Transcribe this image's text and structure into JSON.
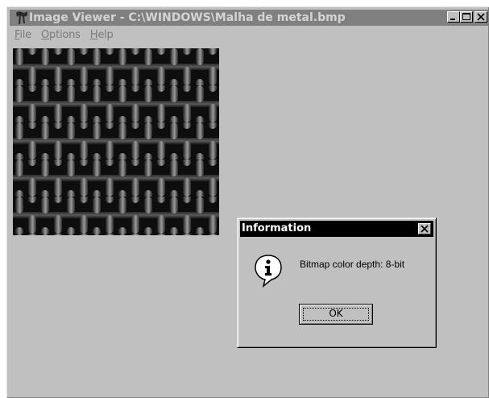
{
  "window": {
    "title": "Image Viewer - C:\\WINDOWS\\Malha de metal.bmp",
    "icon": "image-viewer-app-icon"
  },
  "title_buttons": {
    "minimize": "minimize-icon",
    "maximize": "maximize-icon",
    "close": "close-icon"
  },
  "menu": {
    "items": [
      {
        "accel": "F",
        "rest": "ile"
      },
      {
        "accel": "O",
        "rest": "ptions"
      },
      {
        "accel": "H",
        "rest": "elp"
      }
    ]
  },
  "image": {
    "description_icon": "metal-mesh-bitmap"
  },
  "dialog": {
    "title": "Information",
    "message": "Bitmap color depth: 8-bit",
    "ok_label": "OK",
    "icon": "information-icon"
  },
  "colors": {
    "desktop": "#c0c0c0",
    "inactive_titlebar": "#808080",
    "active_titlebar": "#000000"
  }
}
